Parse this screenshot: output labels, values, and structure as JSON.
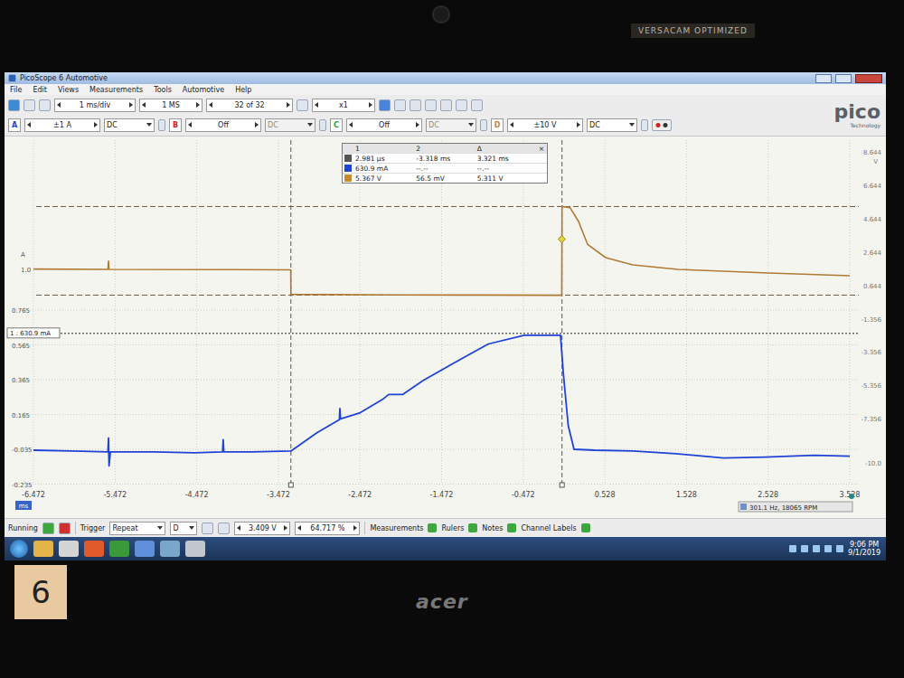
{
  "bezel": {
    "sticker": "VERSACAM OPTIMIZED",
    "brand": "acer",
    "note": "6"
  },
  "window": {
    "title": "PicoScope 6 Automotive"
  },
  "menu": [
    "File",
    "Edit",
    "Views",
    "Measurements",
    "Tools",
    "Automotive",
    "Help"
  ],
  "toolbar": {
    "timebase": "1 ms/div",
    "samples": "1 MS",
    "buffer": "32 of 32",
    "zoom": "x1"
  },
  "channels": [
    {
      "name": "A",
      "range": "±1 A",
      "coupling": "DC",
      "enabled": true,
      "color": "#1f43d6"
    },
    {
      "name": "B",
      "range": "Off",
      "coupling": "DC",
      "enabled": false,
      "color": "#d21f1f"
    },
    {
      "name": "C",
      "range": "Off",
      "coupling": "DC",
      "enabled": false,
      "color": "#1e9e2e"
    },
    {
      "name": "D",
      "range": "±10 V",
      "coupling": "DC",
      "enabled": true,
      "color": "#c9892c"
    }
  ],
  "logo": {
    "name": "pico",
    "sub": "Technology"
  },
  "rulers_table": {
    "header": [
      "1",
      "2",
      "Δ"
    ],
    "close": "×",
    "rows": [
      {
        "cells": [
          "2.981 µs",
          "-3.318 ms",
          "3.321 ms"
        ],
        "color": "#555555"
      },
      {
        "cells": [
          "630.9 mA",
          "--.--",
          "--.--"
        ],
        "color": "#1f43d6"
      },
      {
        "cells": [
          "5.367 V",
          "56.5 mV",
          "5.311 V"
        ],
        "color": "#c9892c"
      }
    ]
  },
  "chart": {
    "x_unit": "ms",
    "x_ticks": [
      "-6.472",
      "-5.472",
      "-4.472",
      "-3.472",
      "-2.472",
      "-1.472",
      "-0.472",
      "0.528",
      "1.528",
      "2.528",
      "3.528"
    ],
    "left_label": "A",
    "left_top": "1.0",
    "left_ticks": [
      "0.765",
      "0.565",
      "0.365",
      "0.165",
      "-0.035",
      "-0.235"
    ],
    "right_unit": "V",
    "right_ticks": [
      "8.644",
      "6.644",
      "4.644",
      "2.644",
      "0.644",
      "-1.356",
      "-3.356",
      "-5.356",
      "-7.356",
      "-10.0"
    ],
    "ruler_tag": "1 : 630.9 mA",
    "readout": "301.1 Hz, 18065 RPM",
    "time_rulers": [
      0.003,
      -3.318
    ],
    "voltage_rulers": [
      5.367,
      0.0565
    ],
    "current_ruler": 0.6309,
    "trigger": {
      "t": 0.0,
      "v": 3.409
    },
    "series": [
      {
        "unit": "A",
        "color": "#1f43d6",
        "t": [
          -6.472,
          -6.0,
          -5.56,
          -5.553,
          -5.546,
          -5.53,
          -5.0,
          -4.5,
          -4.155,
          -4.147,
          -4.14,
          -3.8,
          -3.318,
          -3.0,
          -2.725,
          -2.718,
          -2.71,
          -2.47,
          -2.2,
          -2.12,
          -1.95,
          -1.7,
          -1.345,
          -0.9,
          -0.46,
          -0.016,
          0.02,
          0.08,
          0.15,
          0.4,
          0.87,
          1.4,
          1.98,
          2.5,
          3.09,
          3.528
        ],
        "values": [
          -0.04,
          -0.045,
          -0.05,
          0.03,
          -0.13,
          -0.05,
          -0.05,
          -0.055,
          -0.05,
          0.02,
          -0.05,
          -0.05,
          -0.045,
          0.06,
          0.135,
          0.2,
          0.14,
          0.175,
          0.25,
          0.28,
          0.28,
          0.36,
          0.455,
          0.57,
          0.62,
          0.62,
          0.4,
          0.1,
          -0.035,
          -0.04,
          -0.045,
          -0.06,
          -0.085,
          -0.08,
          -0.07,
          -0.075
        ]
      },
      {
        "unit": "V",
        "color": "#b07a34",
        "t": [
          -6.472,
          -5.56,
          -5.553,
          -5.546,
          -4.0,
          -3.32,
          -3.318,
          -2.0,
          -1.0,
          0.0,
          0.003,
          0.1,
          0.206,
          0.316,
          0.538,
          0.87,
          1.424,
          2.531,
          3.528
        ],
        "values": [
          1.62,
          1.6,
          2.1,
          1.6,
          1.58,
          1.57,
          0.1,
          0.07,
          0.06,
          0.05,
          5.37,
          5.3,
          4.47,
          3.1,
          2.3,
          1.87,
          1.6,
          1.38,
          1.22
        ]
      }
    ]
  },
  "status": {
    "run_state": "Running",
    "running": true,
    "trigger_label": "Trigger",
    "trigger_mode": "Repeat",
    "trigger_source": "D",
    "trigger_level": "3.409 V",
    "pretrigger": "64.717 %",
    "buttons": [
      "Measurements",
      "Rulers",
      "Notes",
      "Channel Labels"
    ]
  },
  "taskbar": {
    "time": "9:06 PM",
    "date": "9/1/2019"
  }
}
